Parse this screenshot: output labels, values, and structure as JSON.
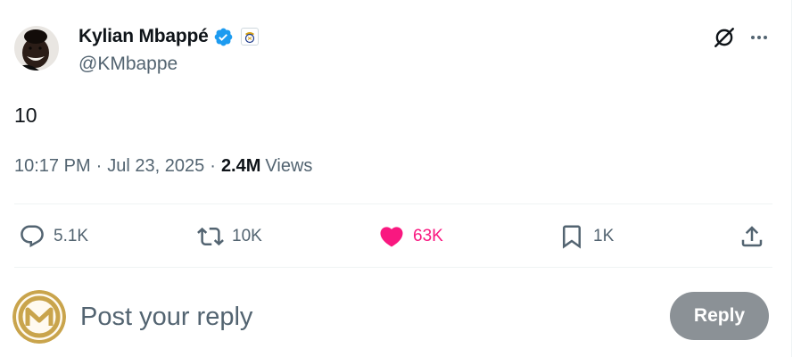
{
  "author": {
    "display_name": "Kylian Mbappé",
    "handle": "@KMbappe",
    "verified_color": "#1d9bf0"
  },
  "tweet": {
    "text": "10",
    "time": "10:17 PM",
    "date": "Jul 23, 2025",
    "separator": "·",
    "views_count": "2.4M",
    "views_label": "Views"
  },
  "actions": {
    "replies": "5.1K",
    "retweets": "10K",
    "likes": "63K",
    "bookmarks": "1K"
  },
  "composer": {
    "placeholder": "Post your reply",
    "reply_button": "Reply"
  },
  "colors": {
    "text_primary": "#0f1419",
    "text_secondary": "#536471",
    "like_active": "#f91880",
    "reply_button_disabled": "#8b9196"
  },
  "icons": {
    "grok": "grok-icon",
    "more": "more-icon",
    "reply": "reply-icon",
    "retweet": "retweet-icon",
    "like": "heart-filled-icon",
    "bookmark": "bookmark-icon",
    "share": "share-icon",
    "verified": "verified-badge-icon",
    "affiliate": "real-madrid-crest-icon"
  }
}
